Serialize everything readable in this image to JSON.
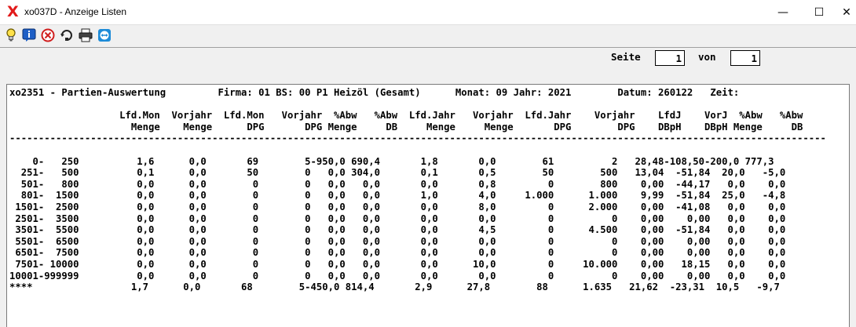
{
  "window": {
    "title": "xo037D - Anzeige Listen",
    "app_icon": "X",
    "minimize_glyph": "—",
    "maximize_glyph": "☐",
    "close_glyph": "✕"
  },
  "toolbar": {
    "icons": [
      "lightbulb-icon",
      "info-icon",
      "cancel-icon",
      "refresh-icon",
      "print-icon",
      "teamviewer-icon"
    ]
  },
  "pager": {
    "page_label": "Seite",
    "page_value": "1",
    "of_label": "von",
    "total_value": "1"
  },
  "report": {
    "header_line": "xo2351 - Partien-Auswertung         Firma: 01 BS: 00 P1 Heizöl (Gesamt)      Monat: 09 Jahr: 2021        Datum: 260122   Zeit:",
    "column_header_1": "                   Lfd.Mon  Vorjahr  Lfd.Mon   Vorjahr  %Abw   %Abw  Lfd.Jahr   Vorjahr  Lfd.Jahr    Vorjahr    LfdJ    VorJ  %Abw   %Abw",
    "column_header_2": "                     Menge    Menge      DPG       DPG Menge     DB     Menge     Menge       DPG        DPG    DBpH    DBpH Menge     DB",
    "separator": "---------------------------------------------------------------------------------------------------------------------------------------------",
    "rows": [
      "    0-   250          1,6      0,0       69        5-950,0 690,4       1,8       0,0        61          2   28,48-108,50-200,0 777,3",
      "  251-   500          0,1      0,0       50        0   0,0 304,0       0,1       0,5        50        500   13,04  -51,84  20,0   -5,0",
      "  501-   800          0,0      0,0        0        0   0,0   0,0       0,0       0,8         0        800    0,00  -44,17   0,0    0,0",
      "  801-  1500          0,0      0,0        0        0   0,0   0,0       1,0       4,0     1.000      1.000    9,99  -51,84  25,0   -4,8",
      " 1501-  2500          0,0      0,0        0        0   0,0   0,0       0,0       8,0         0      2.000    0,00  -41,08   0,0    0,0",
      " 2501-  3500          0,0      0,0        0        0   0,0   0,0       0,0       0,0         0          0    0,00    0,00   0,0    0,0",
      " 3501-  5500          0,0      0,0        0        0   0,0   0,0       0,0       4,5         0      4.500    0,00  -51,84   0,0    0,0",
      " 5501-  6500          0,0      0,0        0        0   0,0   0,0       0,0       0,0         0          0    0,00    0,00   0,0    0,0",
      " 6501-  7500          0,0      0,0        0        0   0,0   0,0       0,0       0,0         0          0    0,00    0,00   0,0    0,0",
      " 7501- 10000          0,0      0,0        0        0   0,0   0,0       0,0      10,0         0     10.000    0,00   18,15   0,0    0,0",
      "10001-999999          0,0      0,0        0        0   0,0   0,0       0,0       0,0         0          0    0,00    0,00   0,0    0,0"
    ],
    "total_row": "****                 1,7      0,0       68        5-450,0 814,4       2,9      27,8        88      1.635   21,62  -23,31  10,5   -9,7"
  }
}
